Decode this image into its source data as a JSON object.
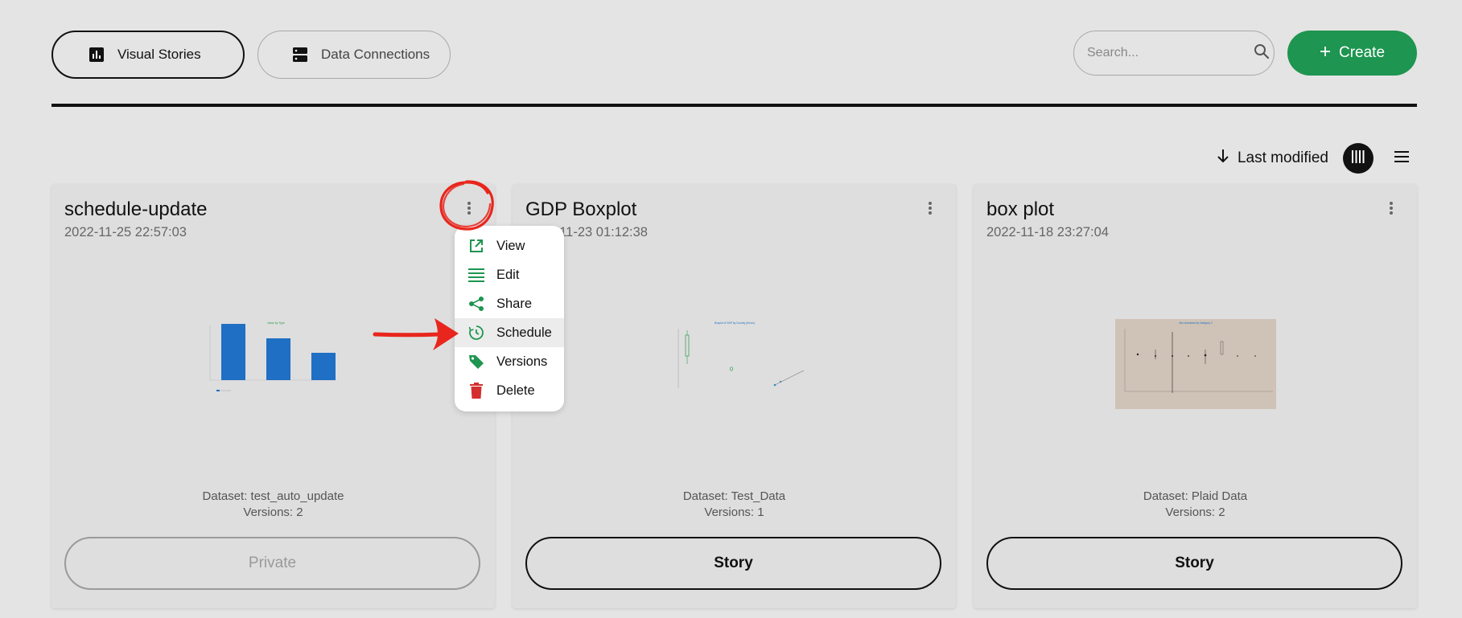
{
  "topbar": {
    "tabs": [
      {
        "label": "Visual Stories",
        "icon": "bar-chart-icon",
        "active": true
      },
      {
        "label": "Data Connections",
        "icon": "server-icon",
        "active": false
      }
    ],
    "search": {
      "placeholder": "Search...",
      "value": ""
    },
    "create_label": "Create"
  },
  "sort": {
    "label": "Last modified",
    "direction": "descending"
  },
  "view_modes": [
    "grid-view-icon",
    "list-view-icon"
  ],
  "cards": [
    {
      "title": "schedule-update",
      "date": "2022-11-25 22:57:03",
      "dataset": "Dataset: test_auto_update",
      "versions": "Versions: 2",
      "action": "Private",
      "thumbnail_title": "Value by Type"
    },
    {
      "title": "GDP Boxplot",
      "date": "2022-11-23 01:12:38",
      "dataset": "Dataset: Test_Data",
      "versions": "Versions: 1",
      "action": "Story",
      "thumbnail_title": "Boxplot of GDP by Country (Errors)"
    },
    {
      "title": "box plot",
      "date": "2022-11-18 23:27:04",
      "dataset": "Dataset: Plaid Data",
      "versions": "Versions: 2",
      "action": "Story",
      "thumbnail_title": "Box chammed by Category 2"
    }
  ],
  "context_menu": {
    "items": [
      {
        "label": "View",
        "icon": "open-external-icon"
      },
      {
        "label": "Edit",
        "icon": "edit-lines-icon"
      },
      {
        "label": "Share",
        "icon": "share-icon"
      },
      {
        "label": "Schedule",
        "icon": "schedule-clock-icon"
      },
      {
        "label": "Versions",
        "icon": "tag-icon"
      },
      {
        "label": "Delete",
        "icon": "trash-icon"
      }
    ],
    "hovered": "Schedule"
  },
  "colors": {
    "background": "#e4e4e4",
    "card": "#dedede",
    "accent_green": "#1e9550",
    "delete_red": "#d32f2f",
    "annotation_red": "#e8261d",
    "thumbnail_blue": "#1f6fc4"
  }
}
